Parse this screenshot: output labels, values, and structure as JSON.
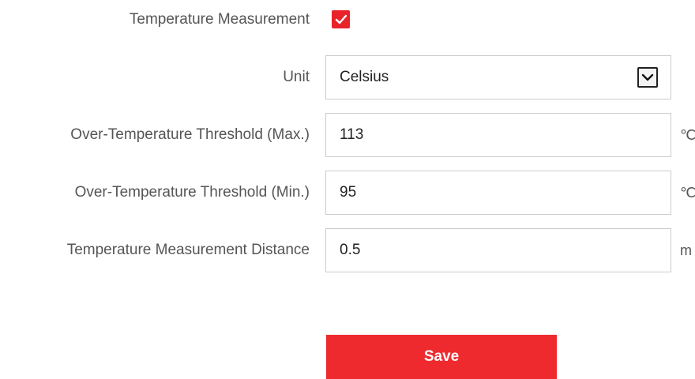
{
  "temperature_measurement": {
    "label": "Temperature Measurement",
    "enabled": true,
    "checkbox_color": "#e8232a"
  },
  "unit": {
    "label": "Unit",
    "value": "Celsius"
  },
  "threshold_max": {
    "label": "Over-Temperature Threshold (Max.)",
    "value": "113",
    "unit": "℃"
  },
  "threshold_min": {
    "label": "Over-Temperature Threshold (Min.)",
    "value": "95",
    "unit": "℃"
  },
  "distance": {
    "label": "Temperature Measurement Distance",
    "value": "0.5",
    "unit": "m"
  },
  "save": {
    "label": "Save",
    "color": "#ef2a2f"
  }
}
